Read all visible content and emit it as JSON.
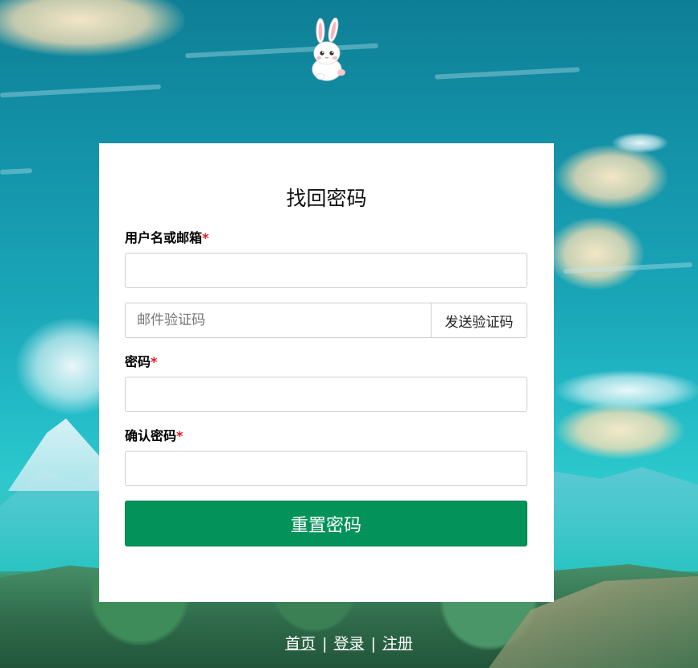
{
  "card": {
    "title": "找回密码",
    "username_label": "用户名或邮箱",
    "username_value": "",
    "required_mark": "*",
    "email_code_placeholder": "邮件验证码",
    "send_code_label": "发送验证码",
    "password_label": "密码",
    "confirm_password_label": "确认密码",
    "submit_label": "重置密码"
  },
  "footer": {
    "links": [
      "首页",
      "登录",
      "注册"
    ],
    "separator": "|"
  },
  "colors": {
    "primary_button": "#03935a",
    "required": "#e0161e"
  },
  "icons": {
    "mascot": "bunny-logo-icon"
  }
}
